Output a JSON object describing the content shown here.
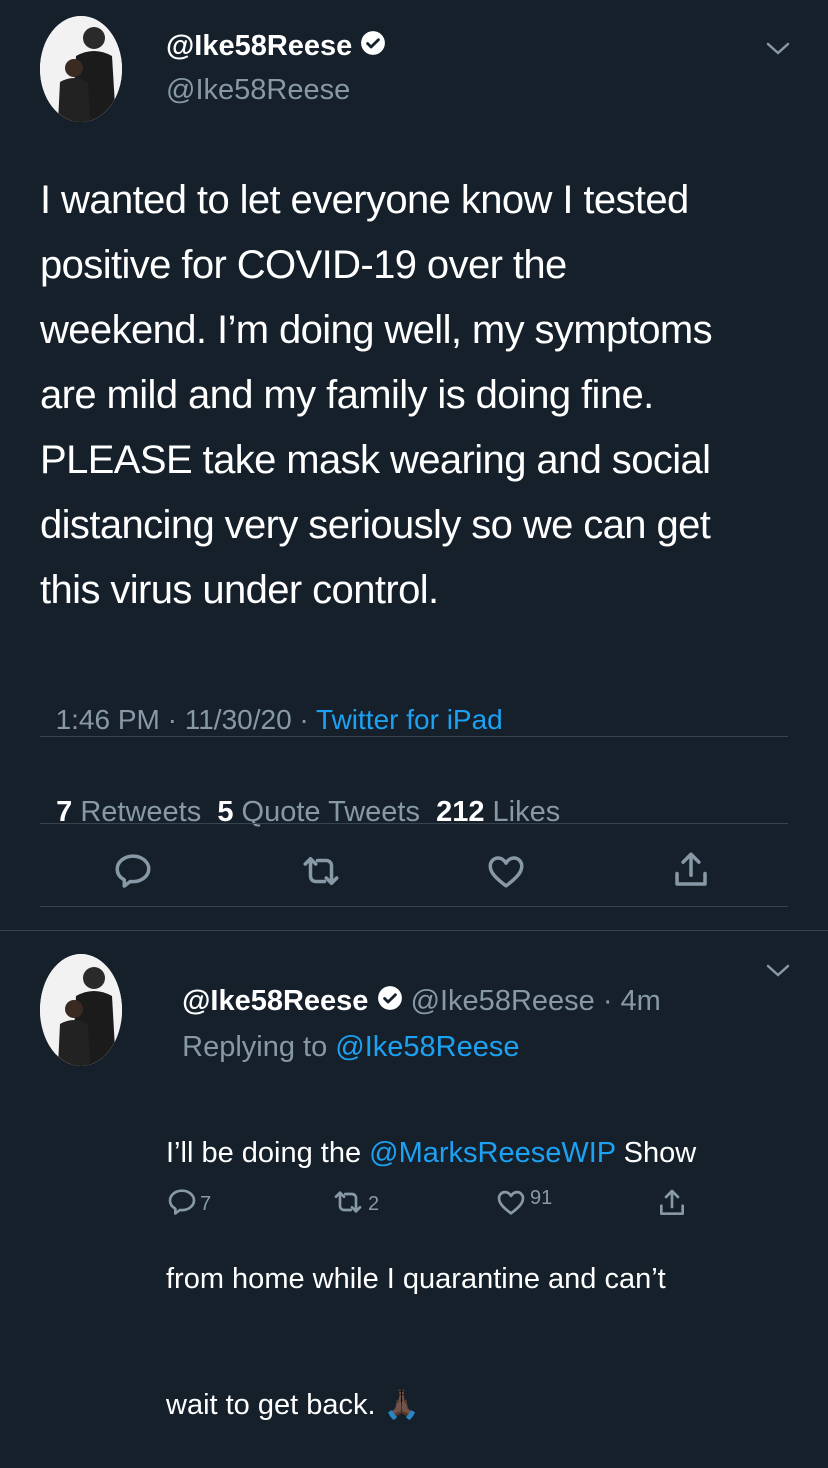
{
  "tweet": {
    "display_name": "@Ike58Reese",
    "handle": "@Ike58Reese",
    "text_lines": [
      "I wanted to let everyone know I tested",
      "positive for COVID-19 over the",
      "weekend. I’m doing well, my symptoms",
      "are mild and my family is doing fine.",
      "PLEASE take mask wearing and social",
      "distancing very seriously so we can get",
      "this virus under control."
    ],
    "time": "1:46 PM · 11/30/20 · ",
    "source": "Twitter for iPad",
    "stats": {
      "retweets_num": "7",
      "retweets_label": "Retweets",
      "quotes_num": "5",
      "quotes_label": "Quote Tweets",
      "likes_num": "212",
      "likes_label": "Likes"
    }
  },
  "reply": {
    "display_name": "@Ike58Reese",
    "handle_time": "@Ike58Reese · 4m",
    "replying_prefix": "Replying to ",
    "replying_to": "@Ike58Reese",
    "line1_pre": "I’ll be doing the ",
    "mention": "@MarksReeseWIP",
    "line1_post": " Show",
    "line2": "from home while I quarantine and can’t",
    "line3": "wait to get back.",
    "emoji": "🙏🏿",
    "counts": {
      "comments": "7",
      "retweets": "2",
      "likes": "91"
    }
  },
  "icons": [
    "avatar",
    "verified-badge-icon",
    "chevron-down-icon",
    "reply-icon",
    "retweet-icon",
    "like-icon",
    "share-icon"
  ],
  "colors": {
    "background": "#15202b",
    "link": "#1da1f2",
    "muted": "#8899a6",
    "divider": "#38444d"
  }
}
